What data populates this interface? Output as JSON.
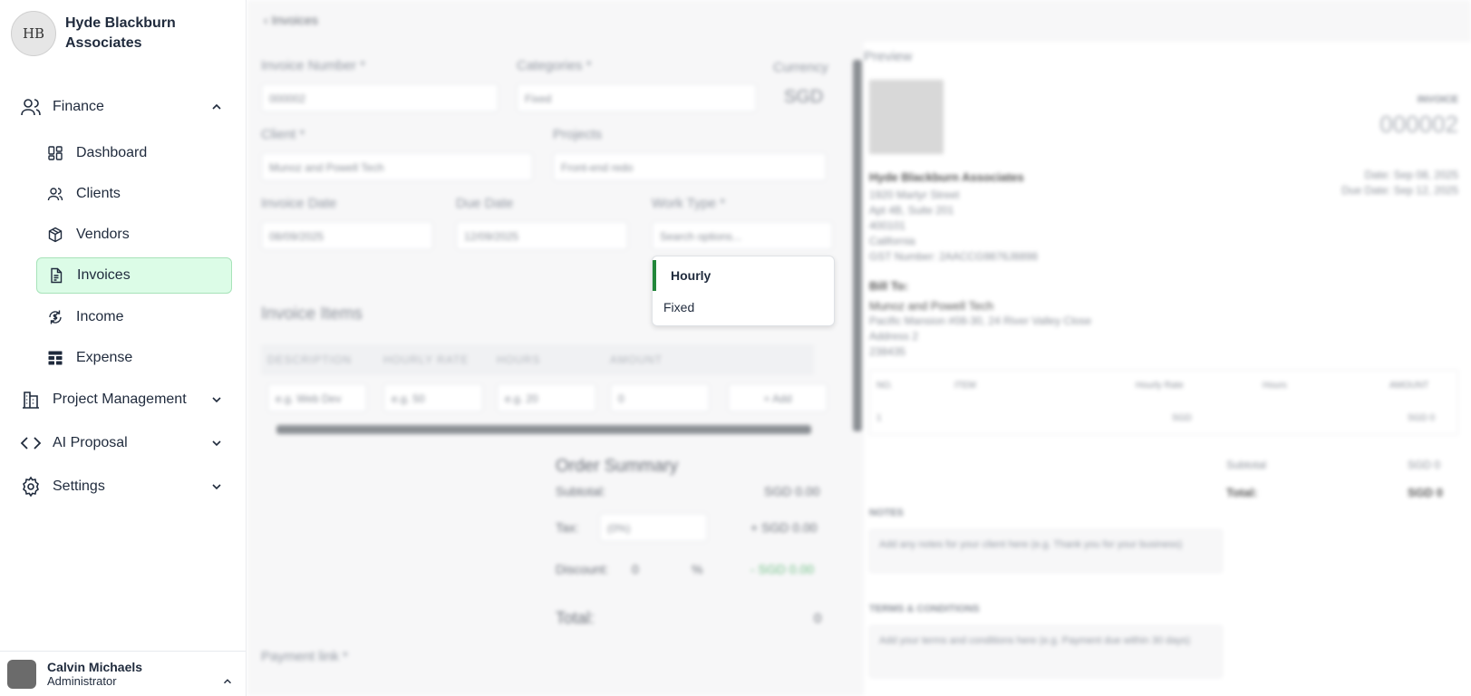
{
  "brand": {
    "name": "Hyde Blackburn Associates",
    "logo_text": "HB"
  },
  "nav": {
    "finance": {
      "label": "Finance",
      "items": [
        "Dashboard",
        "Clients",
        "Vendors",
        "Invoices",
        "Income",
        "Expense"
      ],
      "active": "Invoices"
    },
    "groups": [
      "Project Management",
      "AI Proposal",
      "Settings"
    ]
  },
  "user": {
    "name": "Calvin Michaels",
    "role": "Administrator"
  },
  "main": {
    "breadcrumb": "Invoices",
    "labels": {
      "invoice_number": "Invoice Number *",
      "categories": "Categories *",
      "currency": "Currency",
      "client": "Client *",
      "projects": "Projects",
      "invoice_date": "Invoice Date",
      "due_date": "Due Date",
      "work_type": "Work Type *",
      "invoice_items": "Invoice Items",
      "payment_link": "Payment link *"
    },
    "values": {
      "invoice_number": "000002",
      "category": "Fixed",
      "currency": "SGD",
      "client": "Munoz and Powell Tech",
      "project": "Front-end redo",
      "invoice_date": "08/09/2025",
      "due_date": "12/09/2025",
      "work_type_placeholder": "Search options..."
    },
    "items_table": {
      "headers": [
        "DESCRIPTION",
        "HOURLY RATE",
        "HOURS",
        "AMOUNT"
      ],
      "placeholders": [
        "e.g. Web Dev",
        "e.g. 50",
        "e.g. 20",
        "0"
      ],
      "add_label": "+ Add"
    },
    "summary": {
      "title": "Order Summary",
      "subtotal_label": "Subtotal:",
      "subtotal_value": "SGD 0.00",
      "tax_label": "Tax:",
      "tax_select": "(0%)",
      "tax_value": "+ SGD 0.00",
      "discount_label": "Discount:",
      "discount_input": "0",
      "discount_unit": "%",
      "discount_value": "- SGD 0.00",
      "total_label": "Total:",
      "total_value": "0"
    }
  },
  "preview": {
    "title": "Preview",
    "invoice_label": "INVOICE",
    "invoice_number": "000002",
    "company": "Hyde Blackburn Associates",
    "address": [
      "1920 Martyr Street",
      "Apt 4B, Suite 201",
      "400101",
      "California",
      "GST Number: 2AACCG9876J8898"
    ],
    "date_line": "Date: Sep 08, 2025",
    "due_line": "Due Date: Sep 12, 2025",
    "bill_to_label": "Bill To:",
    "bill_to": [
      "Munoz and Powell Tech",
      "Pacific Mansion #08-30, 24 River Valley Close",
      "Address 2",
      "238435"
    ],
    "table_headers": [
      "NO.",
      "ITEM",
      "Hourly Rate",
      "Hours",
      "AMOUNT"
    ],
    "table_row": [
      "1",
      "",
      "SGD",
      "",
      "SGD 0"
    ],
    "subtotal_label": "Subtotal",
    "subtotal_value": "SGD 0",
    "total_label": "Total:",
    "total_value": "SGD 0",
    "notes_label": "NOTES",
    "notes_placeholder": "Add any notes for your client here (e.g. Thank you for your business)",
    "terms_label": "TERMS & CONDITIONS",
    "terms_placeholder": "Add your terms and conditions here (e.g. Payment due within 30 days)"
  },
  "dropdown": {
    "options": [
      "Hourly",
      "Fixed"
    ],
    "selected": "Hourly"
  }
}
